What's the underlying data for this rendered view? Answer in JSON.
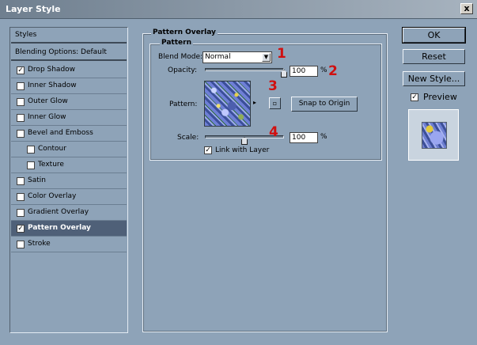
{
  "window": {
    "title": "Layer Style",
    "close_label": "x"
  },
  "styles_list": {
    "header": "Styles",
    "blending": "Blending Options: Default",
    "items": [
      {
        "label": "Drop Shadow",
        "checked": true,
        "selected": false,
        "indent": false
      },
      {
        "label": "Inner Shadow",
        "checked": false,
        "selected": false,
        "indent": false
      },
      {
        "label": "Outer Glow",
        "checked": false,
        "selected": false,
        "indent": false
      },
      {
        "label": "Inner Glow",
        "checked": false,
        "selected": false,
        "indent": false
      },
      {
        "label": "Bevel and Emboss",
        "checked": false,
        "selected": false,
        "indent": false
      },
      {
        "label": "Contour",
        "checked": false,
        "selected": false,
        "indent": true
      },
      {
        "label": "Texture",
        "checked": false,
        "selected": false,
        "indent": true
      },
      {
        "label": "Satin",
        "checked": false,
        "selected": false,
        "indent": false
      },
      {
        "label": "Color Overlay",
        "checked": false,
        "selected": false,
        "indent": false
      },
      {
        "label": "Gradient Overlay",
        "checked": false,
        "selected": false,
        "indent": false
      },
      {
        "label": "Pattern Overlay",
        "checked": true,
        "selected": true,
        "indent": false
      },
      {
        "label": "Stroke",
        "checked": false,
        "selected": false,
        "indent": false
      }
    ]
  },
  "pattern_overlay": {
    "title": "Pattern Overlay",
    "group_title": "Pattern",
    "blend_mode_label": "Blend Mode:",
    "blend_mode_value": "Normal",
    "opacity_label": "Opacity:",
    "opacity_value": "100",
    "opacity_unit": "%",
    "opacity_level": 1.0,
    "pattern_label": "Pattern:",
    "snap_label": "Snap to Origin",
    "scale_label": "Scale:",
    "scale_value": "100",
    "scale_unit": "%",
    "link_label": "Link with Layer",
    "link_checked": true
  },
  "buttons": {
    "ok": "OK",
    "reset": "Reset",
    "new_style": "New Style...",
    "preview_label": "Preview",
    "preview_checked": true
  },
  "annotations": [
    "1",
    "2",
    "3",
    "4"
  ],
  "colors": {
    "dialog_bg": "#8ea3b8",
    "selected_bg": "#4f6078",
    "annotation": "#d01010"
  }
}
